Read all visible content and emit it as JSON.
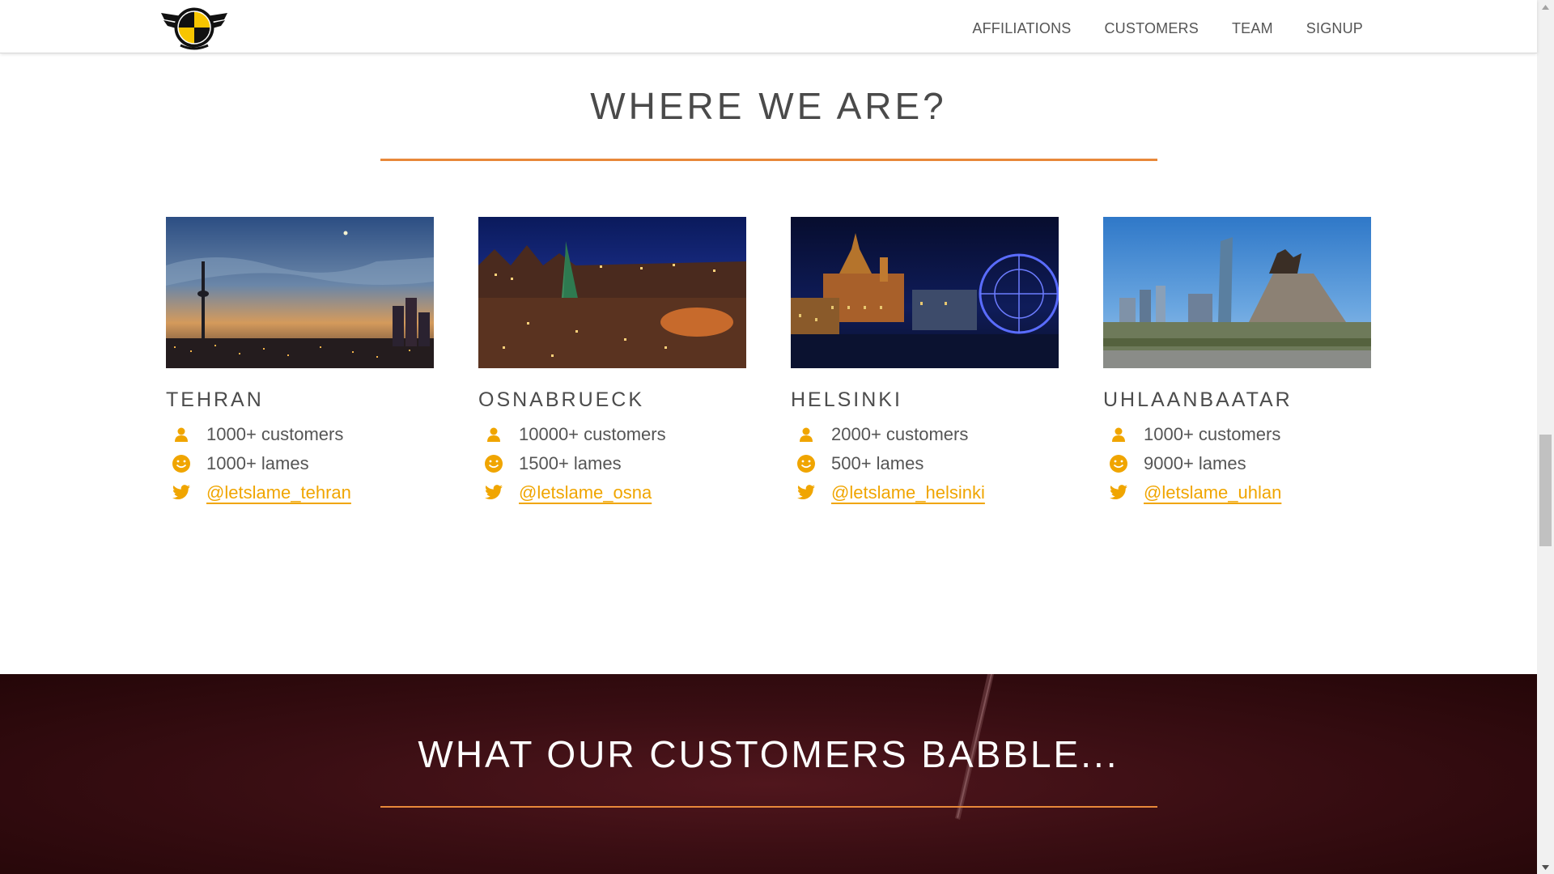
{
  "nav": {
    "logo_alt": "letslame logo",
    "items": [
      {
        "label": "AFFILIATIONS"
      },
      {
        "label": "CUSTOMERS"
      },
      {
        "label": "TEAM"
      },
      {
        "label": "SIGNUP"
      }
    ]
  },
  "where": {
    "title": "WHERE WE ARE?",
    "cities": [
      {
        "name": "TEHRAN",
        "customers": "1000+ customers",
        "lames": "1000+ lames",
        "twitter": "@letslame_tehran"
      },
      {
        "name": "OSNABRUECK",
        "customers": "10000+ customers",
        "lames": "1500+ lames",
        "twitter": "@letslame_osna"
      },
      {
        "name": "HELSINKI",
        "customers": "2000+ customers",
        "lames": "500+ lames",
        "twitter": "@letslame_helsinki"
      },
      {
        "name": "UHLAANBAATAR",
        "customers": "1000+ customers",
        "lames": "9000+ lames",
        "twitter": "@letslame_uhlan"
      }
    ]
  },
  "babble": {
    "title": "WHAT OUR CUSTOMERS BABBLE..."
  },
  "colors": {
    "accent": "#e8883a",
    "link": "#f0a500",
    "dark_section": "#3a0e13"
  },
  "icons": {
    "customers": "user-icon",
    "lames": "smiley-icon",
    "twitter": "twitter-icon"
  },
  "scrollbar": {
    "position_fraction": 0.43
  }
}
